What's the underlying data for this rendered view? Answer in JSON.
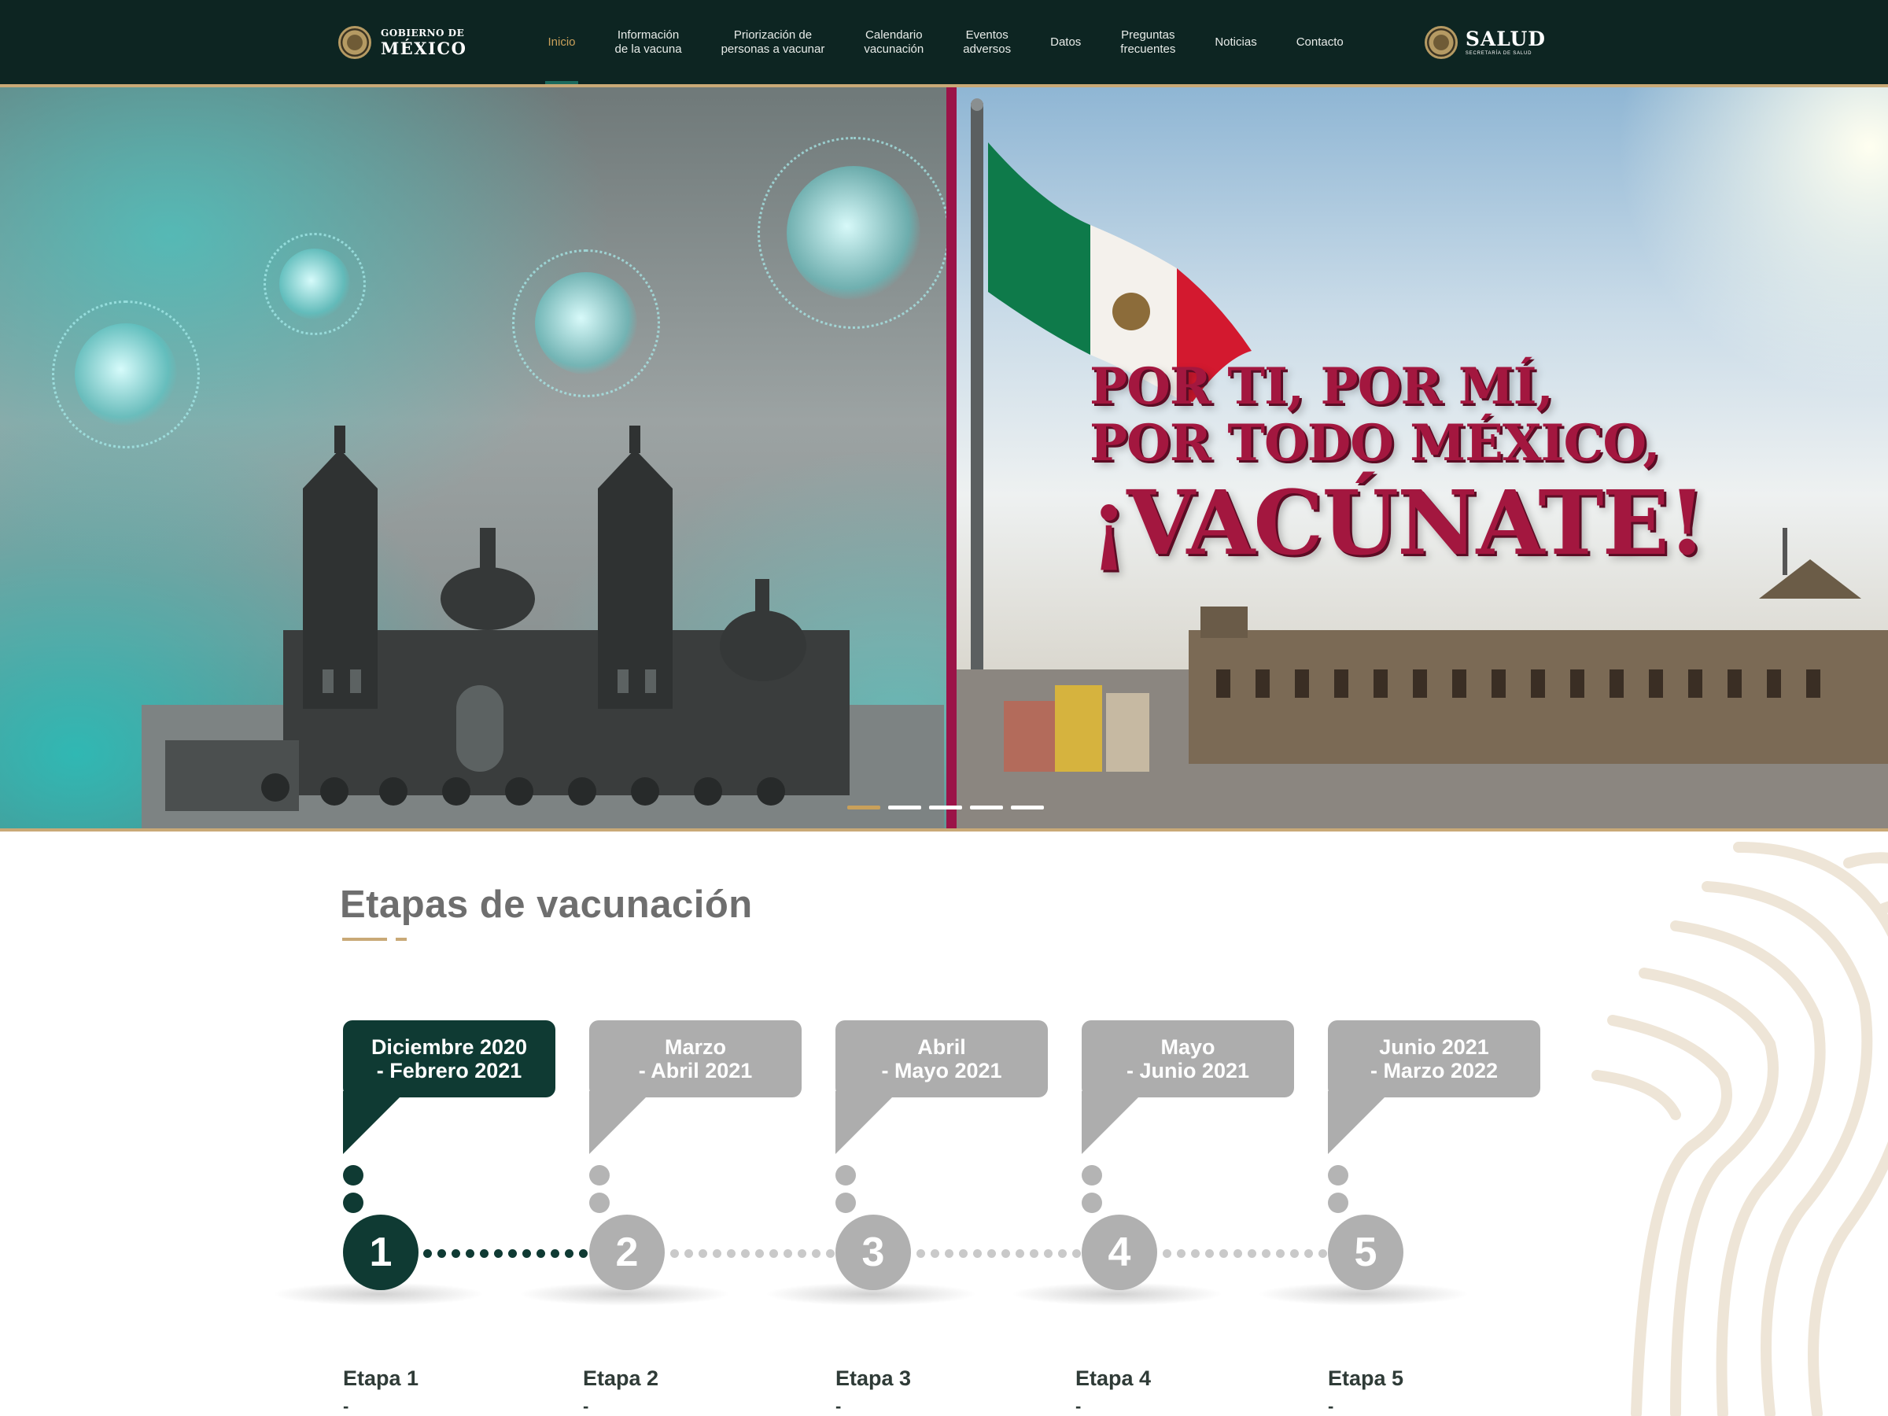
{
  "header": {
    "gov_logo": {
      "line1": "GOBIERNO DE",
      "line2": "MÉXICO"
    },
    "menu": [
      {
        "label": "Inicio",
        "active": true
      },
      {
        "label": "Información\nde la vacuna",
        "active": false
      },
      {
        "label": "Priorización de\npersonas a vacunar",
        "active": false
      },
      {
        "label": "Calendario\nvacunación",
        "active": false
      },
      {
        "label": "Eventos\nadversos",
        "active": false
      },
      {
        "label": "Datos",
        "active": false
      },
      {
        "label": "Preguntas\nfrecuentes",
        "active": false
      },
      {
        "label": "Noticias",
        "active": false
      },
      {
        "label": "Contacto",
        "active": false
      }
    ],
    "salud_logo": {
      "line1": "SALUD",
      "line2": "SECRETARÍA DE SALUD"
    }
  },
  "hero": {
    "slogan_line1": "POR TI, POR MÍ,",
    "slogan_line2": "POR TODO MÉXICO,",
    "slogan_line3": "¡VACÚNATE!",
    "slide_count": 5,
    "active_slide": 1
  },
  "stages_section": {
    "title": "Etapas de vacunación",
    "stages": [
      {
        "period_line1": "Diciembre 2020",
        "period_line2": "- Febrero 2021",
        "number": "1",
        "label": "Etapa 1",
        "dash": "-",
        "active": true
      },
      {
        "period_line1": "Marzo",
        "period_line2": "- Abril 2021",
        "number": "2",
        "label": "Etapa 2",
        "dash": "-",
        "active": false
      },
      {
        "period_line1": "Abril",
        "period_line2": "- Mayo 2021",
        "number": "3",
        "label": "Etapa 3",
        "dash": "-",
        "active": false
      },
      {
        "period_line1": "Mayo",
        "period_line2": "- Junio 2021",
        "number": "4",
        "label": "Etapa 4",
        "dash": "-",
        "active": false
      },
      {
        "period_line1": "Junio 2021",
        "period_line2": "- Marzo 2022",
        "number": "5",
        "label": "Etapa 5",
        "dash": "-",
        "active": false
      }
    ]
  },
  "colors": {
    "nav_bg": "#0d2522",
    "accent_gold": "#c9a05a",
    "active_green": "#0f3a33",
    "inactive_gray": "#adadad",
    "brand_red": "#9b1348"
  }
}
